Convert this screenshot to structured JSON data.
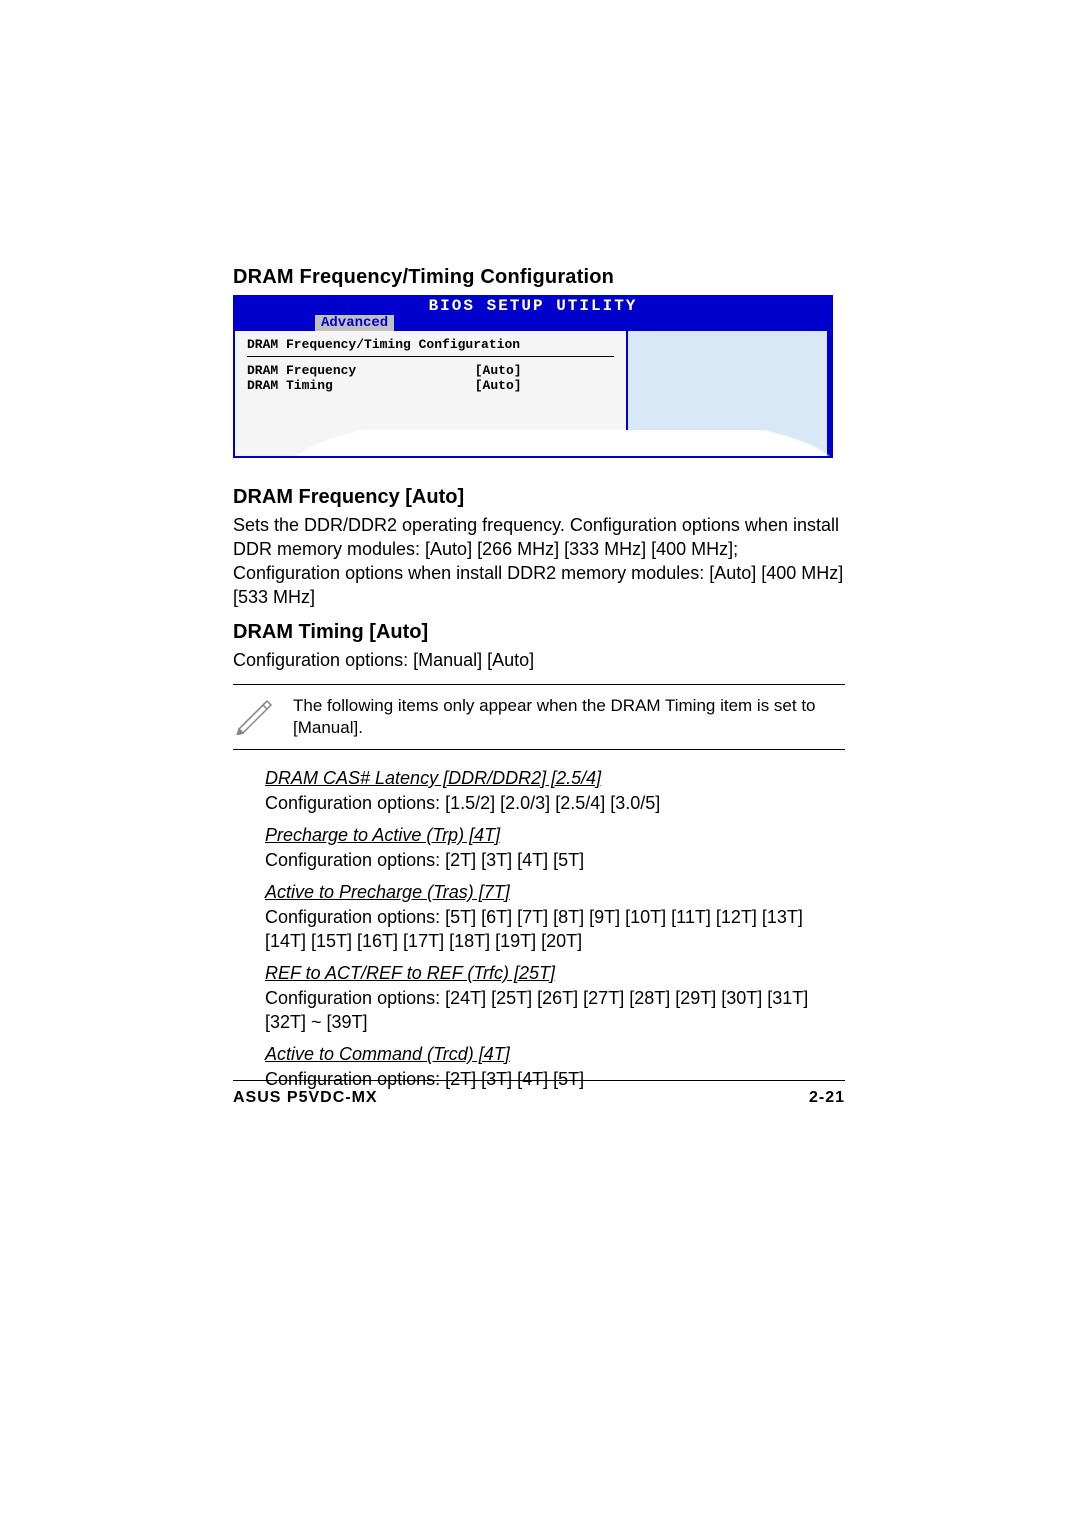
{
  "headings": {
    "main": "DRAM Frequency/Timing Configuration",
    "dram_freq": "DRAM Frequency [Auto]",
    "dram_timing": "DRAM Timing [Auto]"
  },
  "bios": {
    "title": "BIOS SETUP UTILITY",
    "tab": "Advanced",
    "section": "DRAM Frequency/Timing Configuration",
    "rows": [
      {
        "label": "DRAM Frequency",
        "value": "[Auto]"
      },
      {
        "label": "DRAM Timing",
        "value": "[Auto]"
      }
    ]
  },
  "paragraphs": {
    "dram_freq": "Sets the DDR/DDR2 operating frequency. Configuration options when install DDR memory modules: [Auto] [266 MHz] [333 MHz] [400 MHz]; Configuration options when install DDR2 memory modules: [Auto] [400 MHz] [533 MHz]",
    "dram_timing": "Configuration options: [Manual] [Auto]"
  },
  "note": "The following items only appear when the DRAM Timing item is set to [Manual].",
  "subitems": [
    {
      "title": "DRAM CAS# Latency [DDR/DDR2] [2.5/4]",
      "opts": "Configuration options: [1.5/2] [2.0/3] [2.5/4] [3.0/5]"
    },
    {
      "title": "Precharge to Active (Trp) [4T]",
      "opts": "Configuration options: [2T] [3T] [4T] [5T]"
    },
    {
      "title": "Active to Precharge (Tras) [7T]",
      "opts": "Configuration options: [5T] [6T] [7T] [8T] [9T] [10T] [11T] [12T] [13T] [14T] [15T] [16T] [17T] [18T] [19T] [20T]"
    },
    {
      "title": "REF to ACT/REF to REF (Trfc) [25T]",
      "opts": "Configuration options: [24T] [25T] [26T] [27T] [28T] [29T] [30T] [31T] [32T] ~ [39T]"
    },
    {
      "title": "Active to Command (Trcd) [4T]",
      "opts": "Configuration options: [2T] [3T] [4T] [5T]"
    }
  ],
  "footer": {
    "left": "ASUS P5VDC-MX",
    "right": "2-21"
  }
}
